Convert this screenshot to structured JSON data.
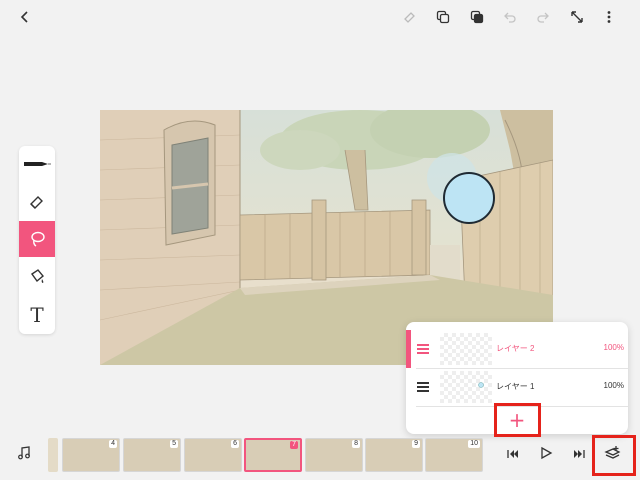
{
  "toolbar": {
    "back": "back-icon",
    "items": [
      "eraser-tag-icon",
      "copy-icon",
      "paste-icon",
      "undo-icon",
      "redo-icon",
      "fullscreen-icon",
      "more-icon"
    ]
  },
  "tools": [
    {
      "name": "pen",
      "icon": "pen-icon"
    },
    {
      "name": "eraser",
      "icon": "eraser-icon"
    },
    {
      "name": "lasso",
      "icon": "lasso-icon",
      "active": true
    },
    {
      "name": "fill",
      "icon": "paint-bucket-icon"
    },
    {
      "name": "text",
      "glyph": "T"
    }
  ],
  "layers": [
    {
      "name": "レイヤー 2",
      "opacity": "100%",
      "active": true
    },
    {
      "name": "レイヤー 1",
      "opacity": "100%",
      "active": false
    }
  ],
  "add_layer_glyph": "+",
  "timeline": {
    "frames": [
      "4",
      "5",
      "6",
      "7",
      "8",
      "9",
      "10"
    ],
    "active_frame": "7"
  },
  "colors": {
    "accent": "#f2557e",
    "highlight": "#e5231b"
  }
}
